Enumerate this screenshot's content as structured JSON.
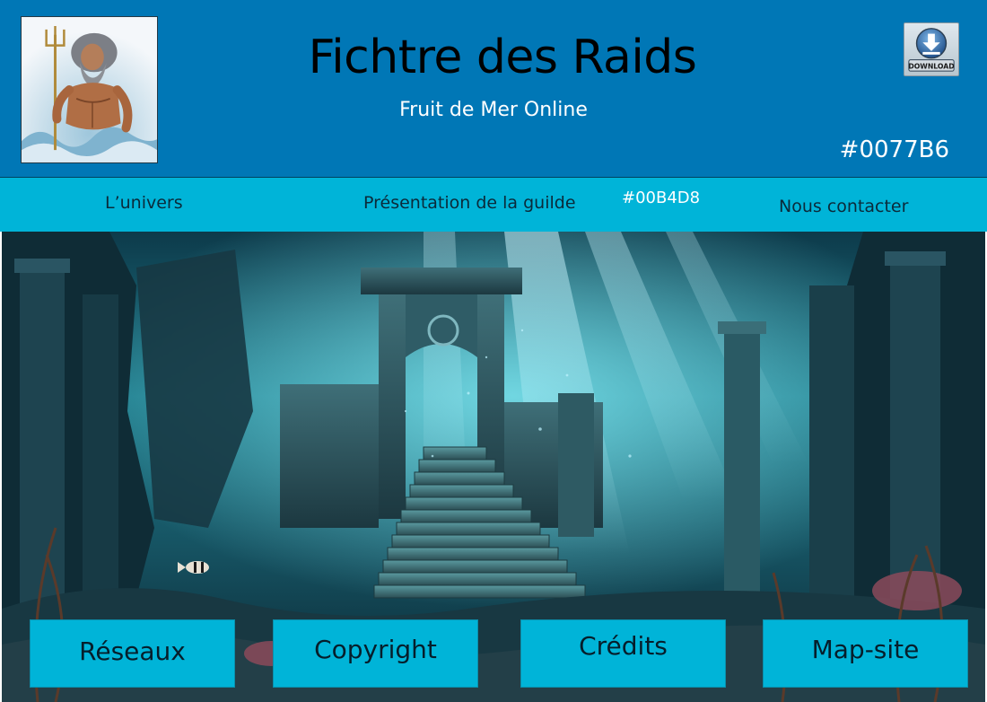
{
  "header": {
    "title": "Fichtre des Raids",
    "subtitle": "Fruit de Mer Online",
    "color_code": "#0077B6",
    "logo_icon": "poseidon-logo-icon",
    "download": {
      "label": "DOWNLOAD",
      "icon": "download-icon"
    }
  },
  "nav": {
    "items": [
      {
        "label": "L’univers"
      },
      {
        "label": "Présentation de la guilde"
      },
      {
        "label": "Nous contacter"
      }
    ],
    "color_code": "#00B4D8"
  },
  "hero": {
    "icon": "underwater-temple-image"
  },
  "footer": {
    "buttons": [
      {
        "label": "Réseaux"
      },
      {
        "label": "Copyright"
      },
      {
        "label": "Crédits"
      },
      {
        "label": "Map-site"
      }
    ]
  },
  "colors": {
    "header_bg": "#0077B6",
    "nav_bg": "#00B4D8",
    "button_bg": "#00B4D8"
  }
}
